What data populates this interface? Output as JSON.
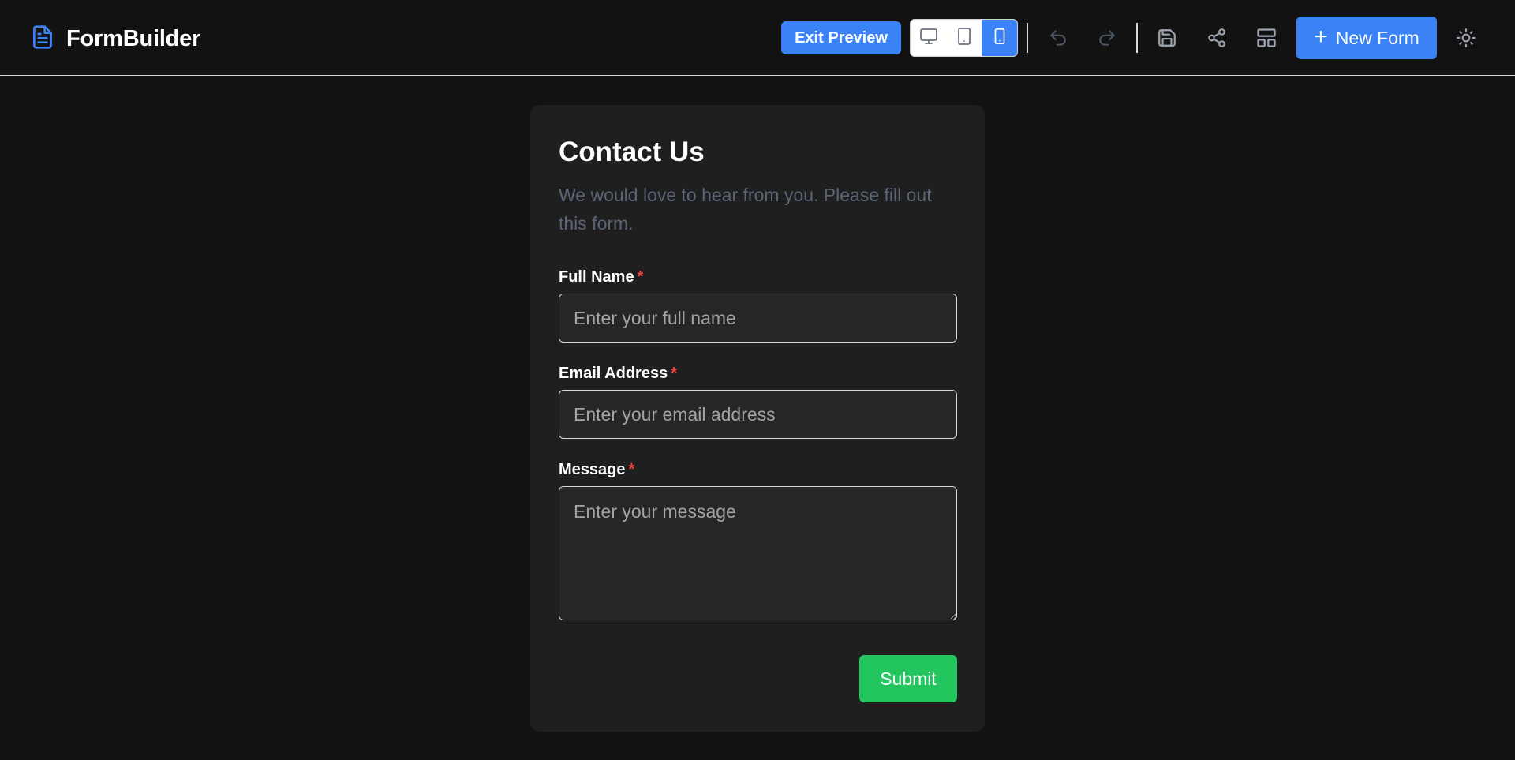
{
  "app": {
    "name": "FormBuilder",
    "logo_icon": "document-icon",
    "accent_color": "#3b82f6"
  },
  "toolbar": {
    "exit_preview_label": "Exit Preview",
    "device_modes": [
      {
        "name": "desktop",
        "icon": "monitor-icon",
        "active": false
      },
      {
        "name": "tablet",
        "icon": "tablet-icon",
        "active": false
      },
      {
        "name": "mobile",
        "icon": "smartphone-icon",
        "active": true
      }
    ],
    "undo_icon": "undo-icon",
    "redo_icon": "redo-icon",
    "save_icon": "save-icon",
    "share_icon": "share-icon",
    "layout_icon": "layout-icon",
    "new_form_label": "New Form",
    "theme_icon": "sun-icon"
  },
  "form": {
    "title": "Contact Us",
    "description": "We would love to hear from you. Please fill out this form.",
    "fields": [
      {
        "label": "Full Name",
        "required_mark": "*",
        "placeholder": "Enter your full name",
        "value": ""
      },
      {
        "label": "Email Address",
        "required_mark": "*",
        "placeholder": "Enter your email address",
        "value": ""
      },
      {
        "label": "Message",
        "required_mark": "*",
        "placeholder": "Enter your message",
        "value": ""
      }
    ],
    "submit_label": "Submit",
    "submit_color": "#22c55e"
  }
}
